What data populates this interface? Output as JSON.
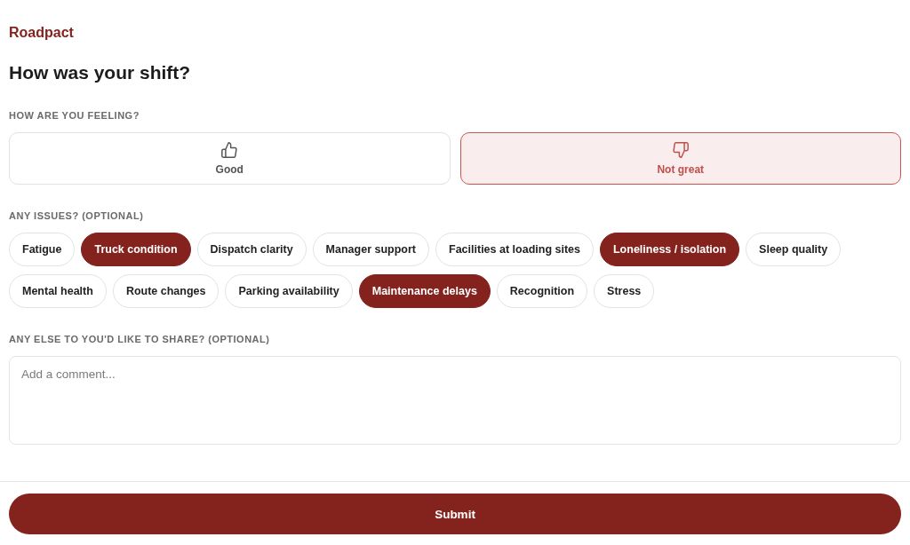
{
  "brand": "Roadpact",
  "title": "How was your shift?",
  "mood": {
    "label": "HOW ARE YOU FEELING?",
    "options": [
      {
        "kind": "thumbs-up",
        "label": "Good",
        "selected": false
      },
      {
        "kind": "thumbs-down",
        "label": "Not great",
        "selected": true
      }
    ]
  },
  "issues": {
    "label": "ANY ISSUES? (OPTIONAL)",
    "chips": [
      {
        "label": "Fatigue",
        "selected": false
      },
      {
        "label": "Truck condition",
        "selected": true
      },
      {
        "label": "Dispatch clarity",
        "selected": false
      },
      {
        "label": "Manager support",
        "selected": false
      },
      {
        "label": "Facilities at loading sites",
        "selected": false
      },
      {
        "label": "Loneliness / isolation",
        "selected": true
      },
      {
        "label": "Sleep quality",
        "selected": false
      },
      {
        "label": "Mental health",
        "selected": false
      },
      {
        "label": "Route changes",
        "selected": false
      },
      {
        "label": "Parking availability",
        "selected": false
      },
      {
        "label": "Maintenance delays",
        "selected": true
      },
      {
        "label": "Recognition",
        "selected": false
      },
      {
        "label": "Stress",
        "selected": false
      }
    ]
  },
  "comment": {
    "label": "ANY ELSE TO YOU'D LIKE TO SHARE? (OPTIONAL)",
    "placeholder": "Add a comment..."
  },
  "submit": "Submit"
}
